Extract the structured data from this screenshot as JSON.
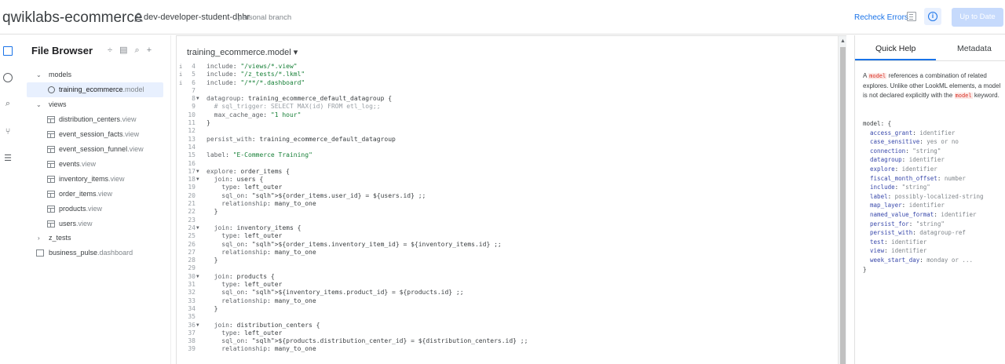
{
  "header": {
    "project": "qwiklabs-ecommerce",
    "branch_user": "dev-developer-student-dhhr",
    "branch_tag": "personal branch",
    "recheck_label": "Recheck Errors",
    "up_to_date_label": "Up to Date",
    "info_icon": "info-icon",
    "file_icon": "file-icon"
  },
  "rail": {
    "icons": [
      "folder-icon",
      "compass-icon",
      "search-icon",
      "git-icon",
      "settings-sliders-icon"
    ]
  },
  "file_browser": {
    "title": "File Browser",
    "actions": "÷ ▤ ⌕ +",
    "folders": {
      "models": "models",
      "views": "views",
      "z_tests": "z_tests"
    },
    "model_file": {
      "name": "training_ecommerce",
      "ext": ".model"
    },
    "view_files": [
      {
        "name": "distribution_centers",
        "ext": ".view"
      },
      {
        "name": "event_session_facts",
        "ext": ".view"
      },
      {
        "name": "event_session_funnel",
        "ext": ".view"
      },
      {
        "name": "events",
        "ext": ".view"
      },
      {
        "name": "inventory_items",
        "ext": ".view"
      },
      {
        "name": "order_items",
        "ext": ".view"
      },
      {
        "name": "products",
        "ext": ".view"
      },
      {
        "name": "users",
        "ext": ".view"
      }
    ],
    "dashboard_file": {
      "name": "business_pulse",
      "ext": ".dashboard"
    }
  },
  "editor": {
    "file_tab": "training_ecommerce.model ▾",
    "lines": [
      {
        "n": "4",
        "i": true,
        "t": "include: \"/views/*.view\""
      },
      {
        "n": "5",
        "i": true,
        "t": "include: \"/z_tests/*.lkml\""
      },
      {
        "n": "6",
        "i": true,
        "t": "include: \"/**/*.dashboard\""
      },
      {
        "n": "7",
        "t": ""
      },
      {
        "n": "8",
        "f": true,
        "t": "datagroup: training_ecommerce_default_datagroup {"
      },
      {
        "n": "9",
        "t": "  # sql_trigger: SELECT MAX(id) FROM etl_log;;"
      },
      {
        "n": "10",
        "t": "  max_cache_age: \"1 hour\""
      },
      {
        "n": "11",
        "t": "}"
      },
      {
        "n": "12",
        "t": ""
      },
      {
        "n": "13",
        "t": "persist_with: training_ecommerce_default_datagroup"
      },
      {
        "n": "14",
        "t": ""
      },
      {
        "n": "15",
        "t": "label: \"E-Commerce Training\""
      },
      {
        "n": "16",
        "t": ""
      },
      {
        "n": "17",
        "f": true,
        "t": "explore: order_items {"
      },
      {
        "n": "18",
        "f": true,
        "t": "  join: users {"
      },
      {
        "n": "19",
        "t": "    type: left_outer"
      },
      {
        "n": "20",
        "t": "    sql_on: ${order_items.user_id} = ${users.id} ;;"
      },
      {
        "n": "21",
        "t": "    relationship: many_to_one"
      },
      {
        "n": "22",
        "t": "  }"
      },
      {
        "n": "23",
        "t": ""
      },
      {
        "n": "24",
        "f": true,
        "t": "  join: inventory_items {"
      },
      {
        "n": "25",
        "t": "    type: left_outer"
      },
      {
        "n": "26",
        "t": "    sql_on: ${order_items.inventory_item_id} = ${inventory_items.id} ;;"
      },
      {
        "n": "27",
        "t": "    relationship: many_to_one"
      },
      {
        "n": "28",
        "t": "  }"
      },
      {
        "n": "29",
        "t": ""
      },
      {
        "n": "30",
        "f": true,
        "t": "  join: products {"
      },
      {
        "n": "31",
        "t": "    type: left_outer"
      },
      {
        "n": "32",
        "t": "    sql_on: ${inventory_items.product_id} = ${products.id} ;;"
      },
      {
        "n": "33",
        "t": "    relationship: many_to_one"
      },
      {
        "n": "34",
        "t": "  }"
      },
      {
        "n": "35",
        "t": ""
      },
      {
        "n": "36",
        "f": true,
        "t": "  join: distribution_centers {"
      },
      {
        "n": "37",
        "t": "    type: left_outer"
      },
      {
        "n": "38",
        "t": "    sql_on: ${products.distribution_center_id} = ${distribution_centers.id} ;;"
      },
      {
        "n": "39",
        "t": "    relationship: many_to_one"
      }
    ]
  },
  "help": {
    "tabs": [
      "Quick Help",
      "Metadata"
    ],
    "desc_1": "A",
    "desc_kw": "model",
    "desc_2": "references a combination of related explores. Unlike other LookML elements, a model is not declared explicitly with the",
    "desc_kw2": "model",
    "desc_3": "keyword.",
    "code_open": "model: {",
    "params": [
      {
        "k": "access_grant",
        "v": "identifier"
      },
      {
        "k": "case_sensitive",
        "v": "yes or no"
      },
      {
        "k": "connection",
        "v": "\"string\""
      },
      {
        "k": "datagroup",
        "v": "identifier"
      },
      {
        "k": "explore",
        "v": "identifier"
      },
      {
        "k": "fiscal_month_offset",
        "v": "number"
      },
      {
        "k": "include",
        "v": "\"string\""
      },
      {
        "k": "label",
        "v": "possibly-localized-string"
      },
      {
        "k": "map_layer",
        "v": "identifier"
      },
      {
        "k": "named_value_format",
        "v": "identifier"
      },
      {
        "k": "persist_for",
        "v": "\"string\""
      },
      {
        "k": "persist_with",
        "v": "datagroup-ref"
      },
      {
        "k": "test",
        "v": "identifier"
      },
      {
        "k": "view",
        "v": "identifier"
      },
      {
        "k": "week_start_day",
        "v": "monday or ..."
      }
    ],
    "code_close": "}"
  }
}
